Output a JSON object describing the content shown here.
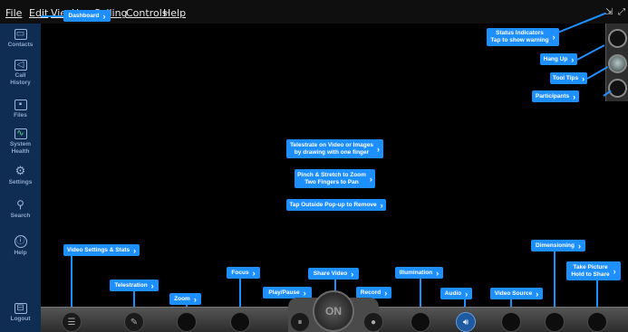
{
  "menu": [
    "File",
    "Edit",
    "View",
    "User",
    "Calling",
    "Controls",
    "Help"
  ],
  "sidebar": {
    "items": [
      {
        "label": "Contacts",
        "icon": "contacts-icon"
      },
      {
        "label": "Call History",
        "icon": "call-history-icon"
      },
      {
        "label": "Files",
        "icon": "files-icon"
      },
      {
        "label": "System Health",
        "icon": "system-health-icon"
      },
      {
        "label": "Settings",
        "icon": "gear-icon"
      },
      {
        "label": "Search",
        "icon": "search-icon"
      },
      {
        "label": "Help",
        "icon": "help-icon"
      }
    ],
    "logout": "Logout"
  },
  "callouts": {
    "dashboard": "Dashboard",
    "status": "Status Indicators\nTap to show warning",
    "hang_up": "Hang Up",
    "tool_tips": "Tool Tips",
    "participants": "Participants",
    "telestrate": "Telestrate on Video or Images\nby drawing with one finger",
    "pinch": "Pinch & Stretch to Zoom\nTwo Fingers to Pan",
    "tap_outside": "Tap Outside Pop-up to Remove",
    "video_settings": "Video Settings & Stats",
    "telestration": "Telestration",
    "zoom": "Zoom",
    "focus": "Focus",
    "play_pause": "Play/Pause",
    "share_video": "Share Video",
    "record": "Record",
    "illumination": "Illumination",
    "audio": "Audio",
    "video_source": "Video Source",
    "dimensioning": "Dimensioning",
    "take_picture": "Take Picture\nHold to Share"
  },
  "toolbar": {
    "on_label": "ON"
  },
  "colors": {
    "accent": "#1e8fff",
    "sidebar": "#0f2c52"
  }
}
